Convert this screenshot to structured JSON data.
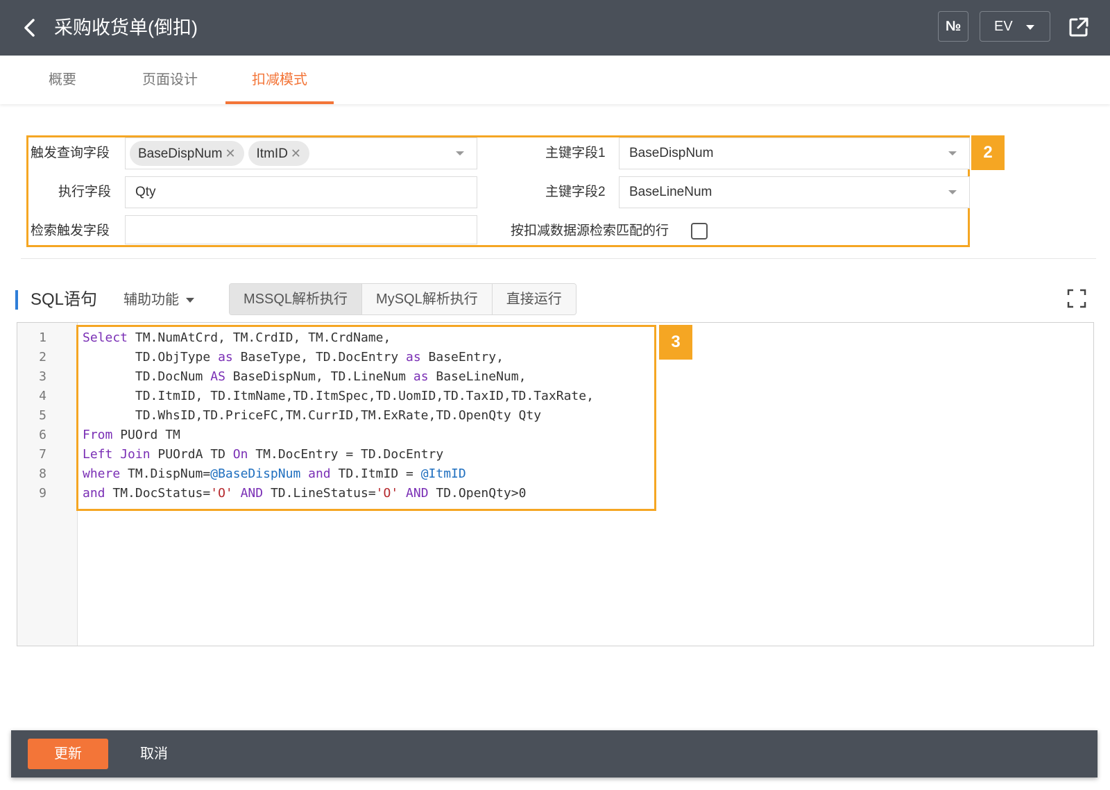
{
  "header": {
    "title": "采购收货单(倒扣)",
    "no_label": "№",
    "ev_label": "EV"
  },
  "tabs": [
    {
      "label": "概要"
    },
    {
      "label": "页面设计"
    },
    {
      "label": "扣减模式"
    }
  ],
  "form": {
    "badge": "2",
    "trigger_query_field": {
      "label": "触发查询字段",
      "tags": [
        "BaseDispNum",
        "ItmID"
      ]
    },
    "exec_field": {
      "label": "执行字段",
      "value": "Qty"
    },
    "search_trigger_field": {
      "label": "检索触发字段",
      "value": ""
    },
    "primary_key_1": {
      "label": "主键字段1",
      "value": "BaseDispNum"
    },
    "primary_key_2": {
      "label": "主键字段2",
      "value": "BaseLineNum"
    },
    "match_by_source": {
      "label": "按扣减数据源检索匹配的行",
      "checked": false
    }
  },
  "sql": {
    "title": "SQL语句",
    "assist_label": "辅助功能",
    "buttons": [
      "MSSQL解析执行",
      "MySQL解析执行",
      "直接运行"
    ],
    "badge": "3",
    "line_numbers": [
      "1",
      "2",
      "3",
      "4",
      "5",
      "6",
      "7",
      "8",
      "9"
    ],
    "lines": [
      "Select TM.NumAtCrd, TM.CrdID, TM.CrdName,",
      "       TD.ObjType as BaseType, TD.DocEntry as BaseEntry,",
      "       TD.DocNum AS BaseDispNum, TD.LineNum as BaseLineNum,",
      "       TD.ItmID, TD.ItmName,TD.ItmSpec,TD.UomID,TD.TaxID,TD.TaxRate,",
      "       TD.WhsID,TD.PriceFC,TM.CurrID,TM.ExRate,TD.OpenQty Qty",
      "From PUOrd TM",
      "Left Join PUOrdA TD On TM.DocEntry = TD.DocEntry",
      "where TM.DispNum=@BaseDispNum and TD.ItmID = @ItmID",
      "and TM.DocStatus='O' AND TD.LineStatus='O' AND TD.OpenQty>0"
    ]
  },
  "footer": {
    "update_label": "更新",
    "cancel_label": "取消"
  },
  "colors": {
    "accent": "#f37538",
    "highlight": "#f5a623",
    "header_bg": "#4a5059"
  }
}
